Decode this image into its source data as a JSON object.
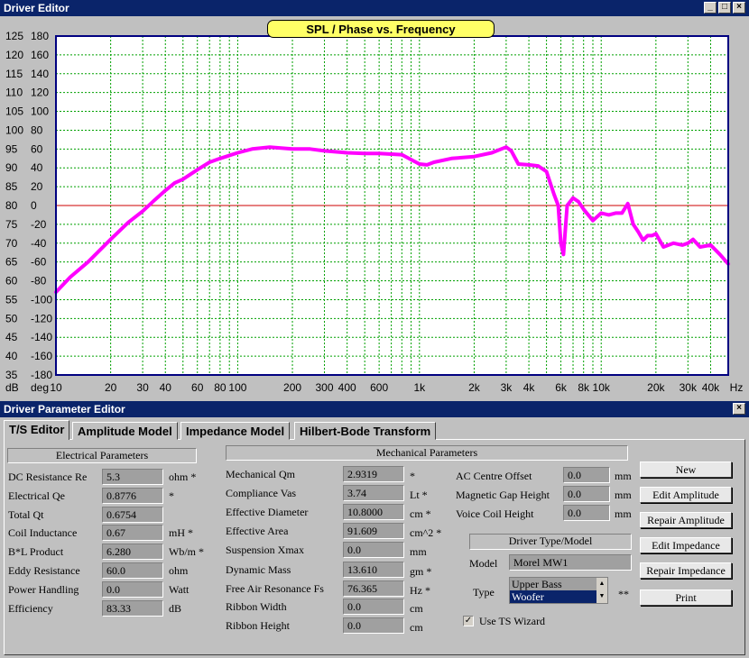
{
  "window1": {
    "title": "Driver Editor"
  },
  "chart_title": "SPL / Phase vs. Frequency",
  "chart_data": {
    "type": "line",
    "title": "SPL / Phase vs. Frequency",
    "xlabel": "Hz",
    "ylabel_left": "dB",
    "ylabel_right": "deg",
    "x_scale": "log",
    "xlim": [
      10,
      50000
    ],
    "ylim": [
      35,
      125
    ],
    "y2lim": [
      -180,
      180
    ],
    "grid": true,
    "x_ticks": [
      "10",
      "20",
      "30",
      "40",
      "60",
      "80",
      "100",
      "200",
      "300",
      "400",
      "600",
      "1k",
      "2k",
      "3k",
      "4k",
      "6k",
      "8k",
      "10k",
      "20k",
      "30k",
      "40k"
    ],
    "y_ticks": [
      "125",
      "120",
      "115",
      "110",
      "105",
      "100",
      "95",
      "90",
      "85",
      "80",
      "75",
      "70",
      "65",
      "60",
      "55",
      "50",
      "45",
      "40",
      "35"
    ],
    "y2_ticks": [
      "180",
      "160",
      "140",
      "120",
      "100",
      "80",
      "60",
      "40",
      "20",
      "0",
      "-20",
      "-40",
      "-60",
      "-80",
      "-100",
      "-120",
      "-140",
      "-160",
      "-180"
    ],
    "series": [
      {
        "color": "#ff00ff",
        "x": [
          10,
          12,
          15,
          20,
          25,
          30,
          35,
          40,
          45,
          50,
          60,
          70,
          80,
          100,
          120,
          150,
          200,
          250,
          300,
          400,
          500,
          600,
          800,
          1000,
          1100,
          1200,
          1500,
          2000,
          2500,
          3000,
          3200,
          3500,
          4000,
          4500,
          5000,
          5500,
          5800,
          6000,
          6200,
          6500,
          7000,
          7500,
          8000,
          9000,
          10000,
          11000,
          12000,
          13000,
          14000,
          15000,
          16000,
          17000,
          18000,
          19000,
          20000,
          22000,
          25000,
          28000,
          30000,
          32000,
          35000,
          40000,
          45000,
          50000
        ],
        "y": [
          57,
          61,
          65,
          71,
          75.5,
          78.5,
          81.5,
          84,
          86,
          87,
          89.5,
          91.5,
          92.5,
          94,
          95,
          95.5,
          95,
          95,
          94.5,
          94,
          93.8,
          93.8,
          93.5,
          91,
          90.8,
          91.5,
          92.5,
          93,
          94,
          95.5,
          94.5,
          91,
          90.8,
          90.5,
          89,
          83,
          80,
          70,
          67,
          80,
          82,
          81,
          79,
          76,
          78,
          77.5,
          78,
          78,
          80.5,
          75,
          73,
          70.8,
          72,
          72,
          72.5,
          69,
          70,
          69.5,
          70,
          71,
          69,
          69.5,
          67,
          64.5
        ]
      }
    ]
  },
  "window2": {
    "title": "Driver Parameter Editor"
  },
  "tabs": [
    "T/S Editor",
    "Amplitude Model",
    "Impedance Model",
    "Hilbert-Bode Transform"
  ],
  "electrical": {
    "header": "Electrical Parameters",
    "rows": [
      {
        "label": "DC Resistance Re",
        "value": "5.3",
        "unit": "ohm *"
      },
      {
        "label": "Electrical Qe",
        "value": "0.8776",
        "unit": "*"
      },
      {
        "label": "Total Qt",
        "value": "0.6754",
        "unit": ""
      },
      {
        "label": "Coil Inductance",
        "value": "0.67",
        "unit": "mH  *"
      },
      {
        "label": "B*L Product",
        "value": "6.280",
        "unit": "Wb/m *"
      },
      {
        "label": "Eddy Resistance",
        "value": "60.0",
        "unit": "ohm"
      },
      {
        "label": "Power Handling",
        "value": "0.0",
        "unit": "Watt"
      },
      {
        "label": "Efficiency",
        "value": "83.33",
        "unit": "dB"
      }
    ]
  },
  "mechanical": {
    "header": "Mechanical Parameters",
    "rows": [
      {
        "label": "Mechanical Qm",
        "value": "2.9319",
        "unit": "*"
      },
      {
        "label": "Compliance Vas",
        "value": "3.74",
        "unit": "Lt  *"
      },
      {
        "label": "Effective Diameter",
        "value": "10.8000",
        "unit": "cm  *"
      },
      {
        "label": "Effective Area",
        "value": "91.609",
        "unit": "cm^2  *"
      },
      {
        "label": "Suspension Xmax",
        "value": "0.0",
        "unit": "mm"
      },
      {
        "label": "Dynamic Mass",
        "value": "13.610",
        "unit": "gm *"
      },
      {
        "label": "Free Air Resonance Fs",
        "value": "76.365",
        "unit": "Hz  *"
      },
      {
        "label": "Ribbon Width",
        "value": "0.0",
        "unit": "cm"
      },
      {
        "label": "Ribbon Height",
        "value": "0.0",
        "unit": "cm"
      }
    ],
    "extra": [
      {
        "label": "AC Centre Offset",
        "value": "0.0",
        "unit": "mm"
      },
      {
        "label": "Magnetic Gap Height",
        "value": "0.0",
        "unit": "mm"
      },
      {
        "label": "Voice Coil Height",
        "value": "0.0",
        "unit": "mm"
      }
    ]
  },
  "driver": {
    "header": "Driver Type/Model",
    "model_label": "Model",
    "model_value": "Morel MW1",
    "type_label": "Type",
    "type_options": [
      "Upper Bass",
      "Woofer"
    ],
    "type_selected": "Woofer",
    "type_note": "**",
    "use_ts_wizard": "Use TS Wizard",
    "use_ts_wizard_checked": true
  },
  "buttons": [
    "New",
    "Edit Amplitude",
    "Repair Amplitude",
    "Edit Impedance",
    "Repair Impedance",
    "Print"
  ]
}
